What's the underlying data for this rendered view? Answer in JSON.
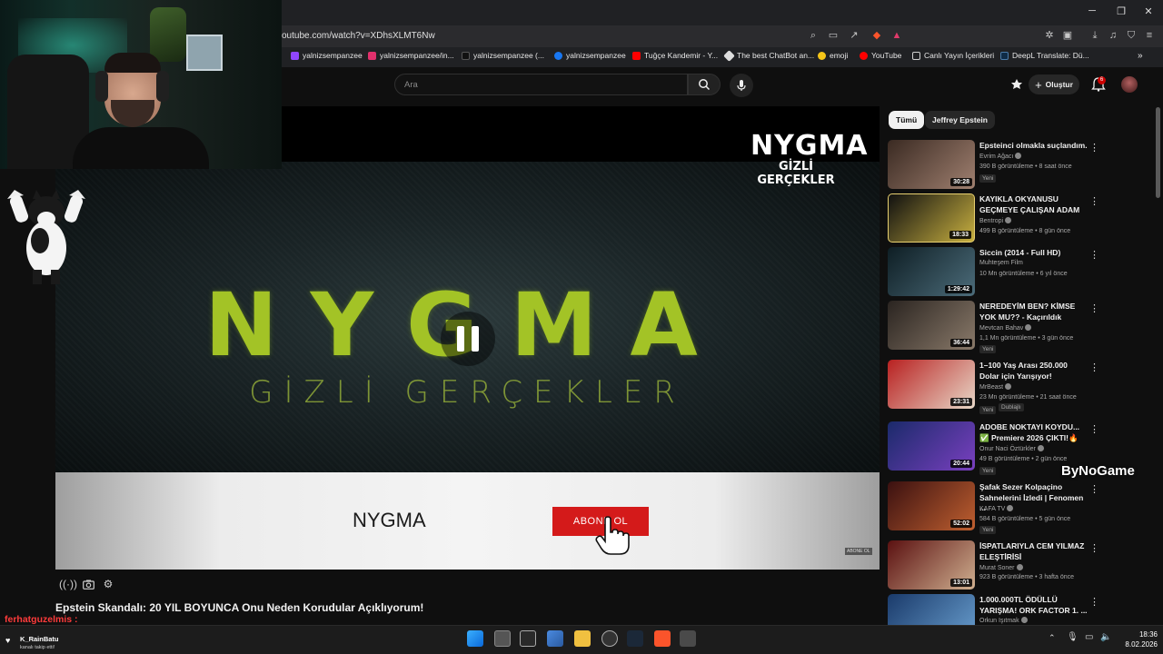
{
  "browser": {
    "url": "outube.com/watch?v=XDhsXLMT6Nw",
    "bookmarks": [
      {
        "label": "yalnizsempanzee",
        "color": "#9146ff"
      },
      {
        "label": "yalnizsempanzee/in...",
        "color": "#e1306c"
      },
      {
        "label": "yalnizsempanzee (...",
        "color": "#111111"
      },
      {
        "label": "yalnizsempanzee",
        "color": "#1877f2"
      },
      {
        "label": "Tuğçe Kandemir - Y...",
        "color": "#ff0000"
      },
      {
        "label": "The best ChatBot an...",
        "color": "#dddddd"
      },
      {
        "label": "emoji",
        "color": "#f5c518"
      },
      {
        "label": "YouTube",
        "color": "#ff0000"
      },
      {
        "label": "Canlı Yayın İçerikleri",
        "color": "#cfcfcf"
      },
      {
        "label": "DeepL Translate: Dü...",
        "color": "#0f2b46"
      }
    ]
  },
  "header": {
    "search_placeholder": "Ara",
    "create_label": "Oluştur",
    "notif_count": "6"
  },
  "video": {
    "overlay_title": "NYGMA",
    "overlay_subtitle": "GİZLİ GERÇEKLER",
    "corner_logo_main": "NYGMA",
    "corner_logo_sub": "GİZLİ GERÇEKLER",
    "banner_channel": "NYGMA",
    "banner_button": "ABONE OL",
    "banner_mini": "ABONE OL",
    "title": "Epstein Skandalı: 20 YIL BOYUNCA Onu Neden Korudular Açıklıyorum!"
  },
  "chat": {
    "user": "ferhatguzelmis :"
  },
  "chips": [
    "Tümü",
    "Jeffrey Epstein"
  ],
  "related": [
    {
      "title": "Epsteinci olmakla suçlandım.",
      "channel": "Evrim Ağacı",
      "meta": "390 B görüntüleme • 8 saat önce",
      "badge": "Yeni",
      "duration": "30:28",
      "colors": [
        "#3a2a22",
        "#a08070"
      ]
    },
    {
      "title": "KAYIKLA OKYANUSU GEÇMEYE ÇALIŞAN ADAM",
      "channel": "Bentropi",
      "meta": "499 B görüntüleme • 8 gün önce",
      "badge": "",
      "duration": "18:33",
      "colors": [
        "#101010",
        "#c8b040"
      ]
    },
    {
      "title": "Siccin (2014 - Full HD)",
      "channel": "Muhteşem Film",
      "meta": "10 Mn görüntüleme • 6 yıl önce",
      "badge": "",
      "duration": "1:29:42",
      "colors": [
        "#0e1e24",
        "#4c6c7a"
      ]
    },
    {
      "title": "NEREDEYİM BEN? KİMSE YOK MU?? - Kaçırıldık",
      "channel": "Mevtcan Bahav",
      "meta": "1,1 Mn görüntüleme • 3 gün önce",
      "badge": "Yeni",
      "duration": "36:44",
      "colors": [
        "#2a2420",
        "#8a7a6a"
      ]
    },
    {
      "title": "1–100 Yaş Arası 250.000 Dolar için Yarışıyor!",
      "channel": "MrBeast",
      "meta": "23 Mn görüntüleme • 21 saat önce",
      "badge": "Yeni",
      "badge2": "Dublajlı",
      "duration": "23:31",
      "colors": [
        "#b82020",
        "#e8d8c8"
      ]
    },
    {
      "title": "ADOBE NOKTAYI KOYDU... ✅ Premiere 2026 ÇIKTI!🔥",
      "channel": "Onur Naci Öztürkler",
      "meta": "49 B görüntüleme • 2 gün önce",
      "badge": "Yeni",
      "duration": "20:44",
      "colors": [
        "#1a2a6a",
        "#7a40c0"
      ]
    },
    {
      "title": "Şafak Sezer Kolpaçino Sahnelerini İzledi | Fenomen ...",
      "channel": "KAFA TV",
      "meta": "584 B görüntüleme • 5 gün önce",
      "badge": "Yeni",
      "duration": "52:02",
      "colors": [
        "#3a1010",
        "#c06030"
      ]
    },
    {
      "title": "İSPATLARIYLA CEM YILMAZ ELEŞTİRİSİ",
      "channel": "Murat Soner",
      "meta": "923 B görüntüleme • 3 hafta önce",
      "badge": "",
      "duration": "13:01",
      "colors": [
        "#5a1010",
        "#d0b090"
      ]
    },
    {
      "title": "1.000.000TL ÖDÜLLÜ YARIŞMA! ORK FACTOR 1. ...",
      "channel": "Orkun Işıtmak",
      "meta": "",
      "badge": "",
      "duration": "",
      "colors": [
        "#1a3a6a",
        "#6aa0d0"
      ]
    }
  ],
  "sponsor": "ByNoGame",
  "follow": {
    "user": "K_RainBatu",
    "text": "kanalı takip etti!"
  },
  "taskbar": {
    "time": "18:36",
    "date": "8.02.2026"
  }
}
